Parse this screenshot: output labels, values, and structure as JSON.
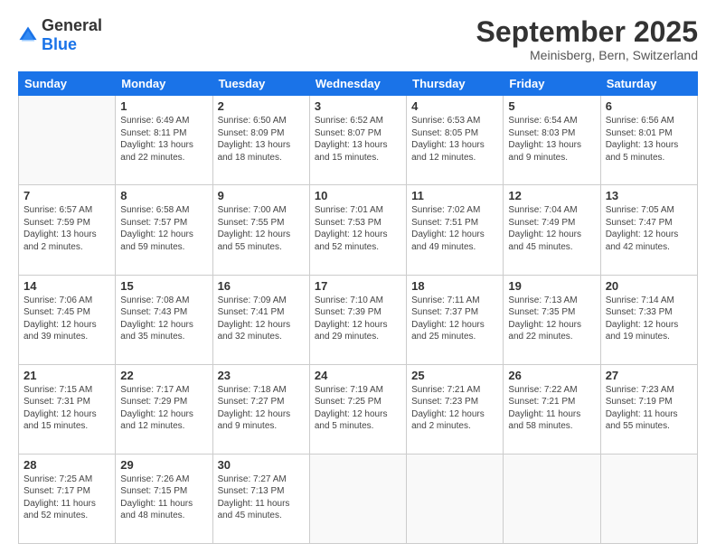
{
  "logo": {
    "general": "General",
    "blue": "Blue"
  },
  "header": {
    "title": "September 2025",
    "subtitle": "Meinisberg, Bern, Switzerland"
  },
  "weekdays": [
    "Sunday",
    "Monday",
    "Tuesday",
    "Wednesday",
    "Thursday",
    "Friday",
    "Saturday"
  ],
  "weeks": [
    [
      {
        "day": "",
        "info": ""
      },
      {
        "day": "1",
        "info": "Sunrise: 6:49 AM\nSunset: 8:11 PM\nDaylight: 13 hours\nand 22 minutes."
      },
      {
        "day": "2",
        "info": "Sunrise: 6:50 AM\nSunset: 8:09 PM\nDaylight: 13 hours\nand 18 minutes."
      },
      {
        "day": "3",
        "info": "Sunrise: 6:52 AM\nSunset: 8:07 PM\nDaylight: 13 hours\nand 15 minutes."
      },
      {
        "day": "4",
        "info": "Sunrise: 6:53 AM\nSunset: 8:05 PM\nDaylight: 13 hours\nand 12 minutes."
      },
      {
        "day": "5",
        "info": "Sunrise: 6:54 AM\nSunset: 8:03 PM\nDaylight: 13 hours\nand 9 minutes."
      },
      {
        "day": "6",
        "info": "Sunrise: 6:56 AM\nSunset: 8:01 PM\nDaylight: 13 hours\nand 5 minutes."
      }
    ],
    [
      {
        "day": "7",
        "info": "Sunrise: 6:57 AM\nSunset: 7:59 PM\nDaylight: 13 hours\nand 2 minutes."
      },
      {
        "day": "8",
        "info": "Sunrise: 6:58 AM\nSunset: 7:57 PM\nDaylight: 12 hours\nand 59 minutes."
      },
      {
        "day": "9",
        "info": "Sunrise: 7:00 AM\nSunset: 7:55 PM\nDaylight: 12 hours\nand 55 minutes."
      },
      {
        "day": "10",
        "info": "Sunrise: 7:01 AM\nSunset: 7:53 PM\nDaylight: 12 hours\nand 52 minutes."
      },
      {
        "day": "11",
        "info": "Sunrise: 7:02 AM\nSunset: 7:51 PM\nDaylight: 12 hours\nand 49 minutes."
      },
      {
        "day": "12",
        "info": "Sunrise: 7:04 AM\nSunset: 7:49 PM\nDaylight: 12 hours\nand 45 minutes."
      },
      {
        "day": "13",
        "info": "Sunrise: 7:05 AM\nSunset: 7:47 PM\nDaylight: 12 hours\nand 42 minutes."
      }
    ],
    [
      {
        "day": "14",
        "info": "Sunrise: 7:06 AM\nSunset: 7:45 PM\nDaylight: 12 hours\nand 39 minutes."
      },
      {
        "day": "15",
        "info": "Sunrise: 7:08 AM\nSunset: 7:43 PM\nDaylight: 12 hours\nand 35 minutes."
      },
      {
        "day": "16",
        "info": "Sunrise: 7:09 AM\nSunset: 7:41 PM\nDaylight: 12 hours\nand 32 minutes."
      },
      {
        "day": "17",
        "info": "Sunrise: 7:10 AM\nSunset: 7:39 PM\nDaylight: 12 hours\nand 29 minutes."
      },
      {
        "day": "18",
        "info": "Sunrise: 7:11 AM\nSunset: 7:37 PM\nDaylight: 12 hours\nand 25 minutes."
      },
      {
        "day": "19",
        "info": "Sunrise: 7:13 AM\nSunset: 7:35 PM\nDaylight: 12 hours\nand 22 minutes."
      },
      {
        "day": "20",
        "info": "Sunrise: 7:14 AM\nSunset: 7:33 PM\nDaylight: 12 hours\nand 19 minutes."
      }
    ],
    [
      {
        "day": "21",
        "info": "Sunrise: 7:15 AM\nSunset: 7:31 PM\nDaylight: 12 hours\nand 15 minutes."
      },
      {
        "day": "22",
        "info": "Sunrise: 7:17 AM\nSunset: 7:29 PM\nDaylight: 12 hours\nand 12 minutes."
      },
      {
        "day": "23",
        "info": "Sunrise: 7:18 AM\nSunset: 7:27 PM\nDaylight: 12 hours\nand 9 minutes."
      },
      {
        "day": "24",
        "info": "Sunrise: 7:19 AM\nSunset: 7:25 PM\nDaylight: 12 hours\nand 5 minutes."
      },
      {
        "day": "25",
        "info": "Sunrise: 7:21 AM\nSunset: 7:23 PM\nDaylight: 12 hours\nand 2 minutes."
      },
      {
        "day": "26",
        "info": "Sunrise: 7:22 AM\nSunset: 7:21 PM\nDaylight: 11 hours\nand 58 minutes."
      },
      {
        "day": "27",
        "info": "Sunrise: 7:23 AM\nSunset: 7:19 PM\nDaylight: 11 hours\nand 55 minutes."
      }
    ],
    [
      {
        "day": "28",
        "info": "Sunrise: 7:25 AM\nSunset: 7:17 PM\nDaylight: 11 hours\nand 52 minutes."
      },
      {
        "day": "29",
        "info": "Sunrise: 7:26 AM\nSunset: 7:15 PM\nDaylight: 11 hours\nand 48 minutes."
      },
      {
        "day": "30",
        "info": "Sunrise: 7:27 AM\nSunset: 7:13 PM\nDaylight: 11 hours\nand 45 minutes."
      },
      {
        "day": "",
        "info": ""
      },
      {
        "day": "",
        "info": ""
      },
      {
        "day": "",
        "info": ""
      },
      {
        "day": "",
        "info": ""
      }
    ]
  ]
}
